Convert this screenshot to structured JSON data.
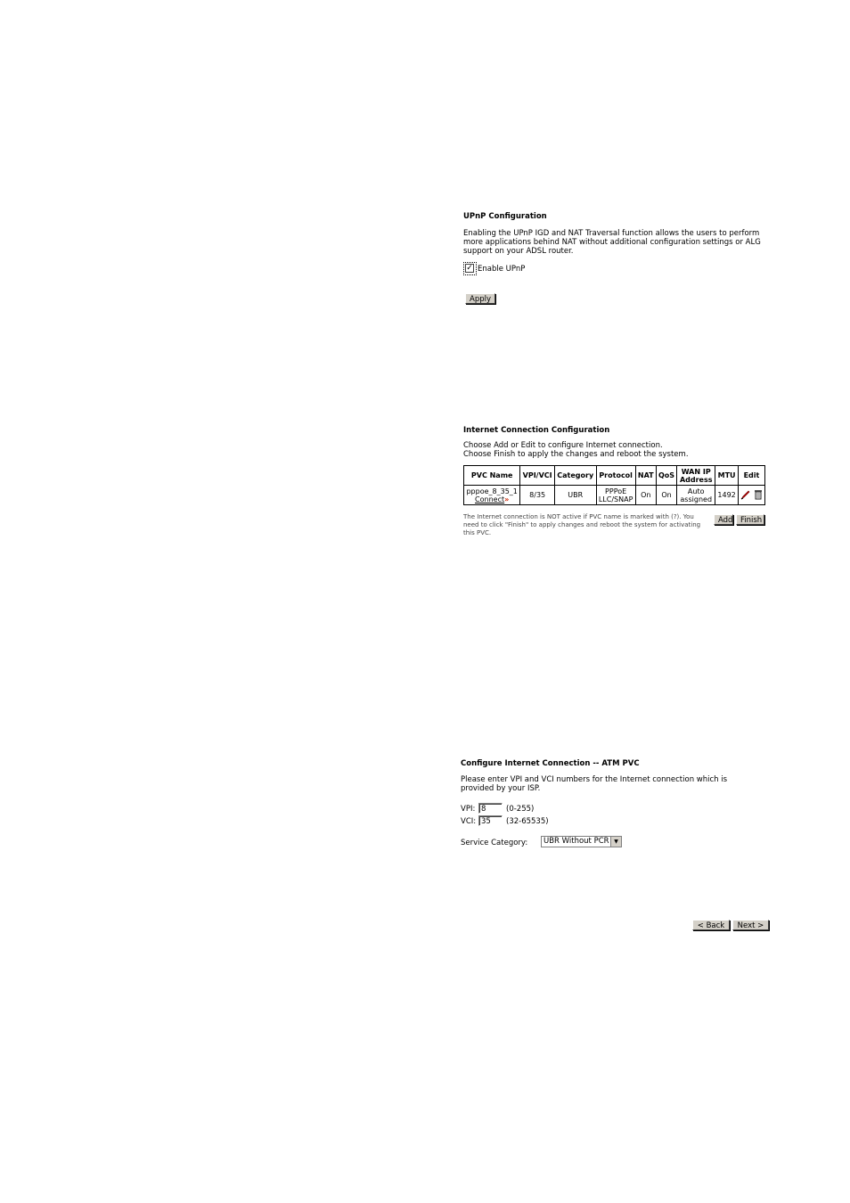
{
  "upnp": {
    "title": "UPnP Configuration",
    "description_line1": "Enabling the UPnP IGD and NAT Traversal function allows the users to perform",
    "description_line2": "more applications behind NAT without additional configuration settings or ALG",
    "description_line3": "support on your ADSL router.",
    "checkbox_label": "Enable UPnP",
    "checkbox_checked": true,
    "checkbox_mark": "✓",
    "apply_label": "Apply"
  },
  "internet": {
    "title": "Internet Connection Configuration",
    "instruction_line1": "Choose Add or Edit to configure Internet connection.",
    "instruction_line2": "Choose Finish to apply the changes and reboot the system.",
    "columns": [
      "PVC Name",
      "VPI/VCI",
      "Category",
      "Protocol",
      "NAT",
      "QoS",
      "WAN IP Address",
      "MTU",
      "Edit"
    ],
    "row": {
      "pvc_name": "pppoe_8_35_1",
      "connect_label": "Connect",
      "vpi_vci": "8/35",
      "category": "UBR",
      "protocol_line1": "PPPoE",
      "protocol_line2": "LLC/SNAP",
      "nat": "On",
      "qos": "On",
      "wan_line1": "Auto",
      "wan_line2": "assigned",
      "mtu": "1492"
    },
    "note_line1": "The Internet connection is NOT active if PVC name is marked with (?). You",
    "note_line2": "need to click \"Finish\" to apply changes and reboot the system for activating",
    "note_line3": "this PVC.",
    "add_label": "Add",
    "finish_label": "Finish"
  },
  "atm": {
    "title": "Configure Internet Connection -- ATM PVC",
    "description_line1": "Please enter VPI and VCI numbers for the Internet connection which is",
    "description_line2": "provided by your ISP.",
    "vpi_label": "VPI:",
    "vpi_value": "8",
    "vpi_range": "(0-255)",
    "vci_label": "VCI:",
    "vci_value": "35",
    "vci_range": "(32-65535)",
    "service_label": "Service Category:",
    "service_value": "UBR Without PCR",
    "back_label": "< Back",
    "next_label": "Next >"
  },
  "colors": {
    "button_face": "#d4d0c8",
    "connect_icon": "#cc2200",
    "edit_icon": "#cc0000"
  }
}
